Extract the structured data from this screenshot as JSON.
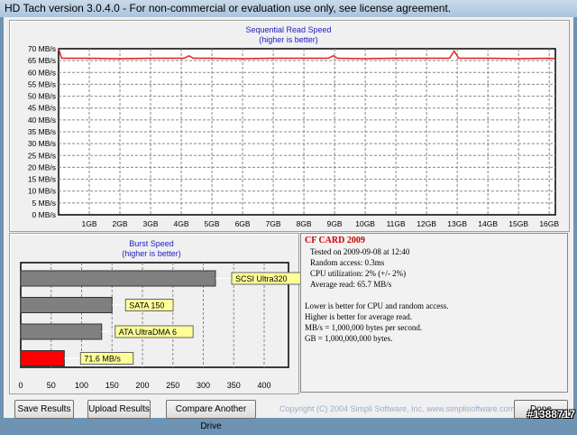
{
  "window": {
    "title": "HD Tach version 3.0.4.0  - For non-commercial or evaluation use only, see license agreement."
  },
  "chart_data": [
    {
      "type": "line",
      "title": "Sequential Read Speed",
      "subtitle": "(higher is better)",
      "ylim": [
        0,
        70
      ],
      "yticks": [
        "0 MB/s",
        "5 MB/s",
        "10 MB/s",
        "15 MB/s",
        "20 MB/s",
        "25 MB/s",
        "30 MB/s",
        "35 MB/s",
        "40 MB/s",
        "45 MB/s",
        "50 MB/s",
        "55 MB/s",
        "60 MB/s",
        "65 MB/s",
        "70 MB/s"
      ],
      "xticks": [
        "1GB",
        "2GB",
        "3GB",
        "4GB",
        "5GB",
        "6GB",
        "7GB",
        "8GB",
        "9GB",
        "10GB",
        "11GB",
        "12GB",
        "13GB",
        "14GB",
        "15GB",
        "16GB"
      ],
      "xlim": [
        0,
        16.2
      ],
      "grid": true,
      "color": "#e02020",
      "series": [
        {
          "x": [
            0,
            0.1,
            0.3,
            1,
            2,
            3,
            4,
            4.1,
            4.25,
            4.4,
            5,
            6,
            7,
            8,
            8.8,
            8.95,
            9.1,
            10,
            11,
            12,
            12.75,
            12.9,
            13.05,
            14,
            15,
            16,
            16.2
          ],
          "y": [
            70,
            66,
            66,
            66,
            65.8,
            66,
            66,
            66,
            67,
            66,
            66,
            65.8,
            66,
            66,
            66,
            67,
            66,
            65.8,
            66,
            66,
            66,
            69,
            66,
            66,
            65.8,
            66,
            65.8
          ]
        }
      ]
    },
    {
      "type": "bar",
      "orientation": "horizontal",
      "title": "Burst Speed",
      "subtitle": "(higher is better)",
      "xlim": [
        0,
        440
      ],
      "xticks": [
        "0",
        "50",
        "100",
        "150",
        "200",
        "250",
        "300",
        "350",
        "400"
      ],
      "grid": true,
      "categories": [
        "SCSI Ultra320",
        "SATA 150",
        "ATA UltraDMA 6",
        "71.6 MB/s"
      ],
      "values": [
        320,
        150,
        133,
        71.6
      ],
      "colors": [
        "#808080",
        "#808080",
        "#808080",
        "#ff0000"
      ]
    }
  ],
  "info": {
    "drive": "CF CARD 2009",
    "tested": "Tested on 2009-09-08 at 12:40",
    "random": "Random access: 0.3ms",
    "cpu": "CPU utilization: 2% (+/- 2%)",
    "avg": "Average read: 65.7 MB/s",
    "notes": [
      "Lower is better for CPU and random access.",
      "Higher is better for average read.",
      "MB/s = 1,000,000 bytes per second.",
      "GB = 1,000,000,000 bytes."
    ]
  },
  "buttons": {
    "save": "Save Results",
    "upload": "Upload Results",
    "compare": "Compare Another Drive",
    "done": "Done"
  },
  "footer": {
    "copyright": "Copyright (C) 2004 Simpli Software, Inc. www.simplisoftware.com",
    "watermark": "#1388717"
  }
}
